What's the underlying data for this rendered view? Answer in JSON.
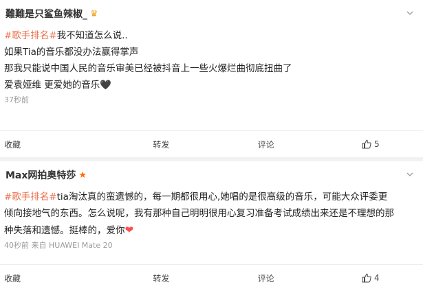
{
  "posts": [
    {
      "username": "難難是只鲨鱼辣椒_",
      "badge_icon": "crown-icon",
      "lines": [
        {
          "hashtag": "#歌手排名#",
          "text": "我不知道怎么说.."
        },
        {
          "hashtag": "",
          "text": "如果Tia的音乐都没办法赢得掌声"
        },
        {
          "hashtag": "",
          "text": "那我只能说中国人民的音乐审美已经被抖音上一些火爆烂曲彻底扭曲了"
        },
        {
          "hashtag": "",
          "text": "爱袁娅维 更爱她的音乐",
          "suffix": "🖤"
        }
      ],
      "time": "37秒前",
      "source": "",
      "actions": {
        "favorite": "收藏",
        "repost": "转发",
        "comment": "评论",
        "likes": "5"
      }
    },
    {
      "username": "Max网拍奥特莎",
      "badge_icon": "star-icon",
      "lines": [
        {
          "hashtag": "#歌手排名#",
          "text": "tia淘汰真的蛮遗憾的，每一期都很用心,她唱的是很高级的音乐，可能大众评委更"
        },
        {
          "hashtag": "",
          "text": "倾向接地气的东西。怎么说呢，我有那种自己明明很用心复习准备考试成绩出来还是不理想的那"
        },
        {
          "hashtag": "",
          "text": "种失落和遗憾。挺棒的，爱你",
          "suffix": "❤"
        }
      ],
      "time": "40秒前",
      "source": "来自 HUAWEI Mate 20",
      "actions": {
        "favorite": "收藏",
        "repost": "转发",
        "comment": "评论",
        "likes": "4"
      }
    }
  ],
  "colors": {
    "hashtag": "#eb7350",
    "meta": "#9a9a9a",
    "separator": "#f2f2f2"
  }
}
